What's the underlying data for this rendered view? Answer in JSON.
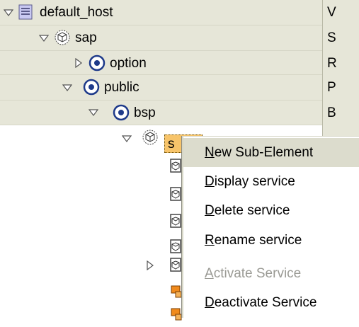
{
  "tree": {
    "nodes": [
      {
        "label": "default_host",
        "desc": "V",
        "icon": "host-icon",
        "expanded": true
      },
      {
        "label": "sap",
        "desc": "S",
        "icon": "service-node-icon",
        "expanded": true
      },
      {
        "label": "option",
        "desc": "R",
        "icon": "active-service-icon",
        "expanded": false
      },
      {
        "label": "public",
        "desc": "P",
        "icon": "active-service-icon",
        "expanded": true
      },
      {
        "label": "bsp",
        "desc": "B",
        "icon": "active-service-icon",
        "expanded": true
      },
      {
        "label": "s",
        "desc": "",
        "icon": "service-node-icon",
        "expanded": true,
        "selected": true
      }
    ]
  },
  "context_menu": {
    "items": [
      {
        "label": "New Sub-Element",
        "mnemonic": "N",
        "rest": "ew Sub-Element",
        "enabled": true,
        "highlighted": true
      },
      {
        "label": "Display service",
        "mnemonic": "D",
        "rest": "isplay service",
        "enabled": true,
        "highlighted": false
      },
      {
        "label": "Delete service",
        "mnemonic": "D",
        "rest": "elete service",
        "enabled": true,
        "highlighted": false
      },
      {
        "label": "Rename service",
        "mnemonic": "R",
        "rest": "ename service",
        "enabled": true,
        "highlighted": false
      },
      {
        "label": "Activate Service",
        "mnemonic": "A",
        "rest": "ctivate Service",
        "enabled": false,
        "highlighted": false
      },
      {
        "label": "Deactivate Service",
        "mnemonic": "D",
        "rest": "eactivate Service",
        "enabled": true,
        "highlighted": false
      }
    ]
  },
  "colors": {
    "row_shade": "#e6e6d8",
    "selection": "#f7c46a",
    "menu_highlight": "#dcdccd",
    "active_icon": "#1e3a8a",
    "disabled_text": "#9a9a94"
  }
}
